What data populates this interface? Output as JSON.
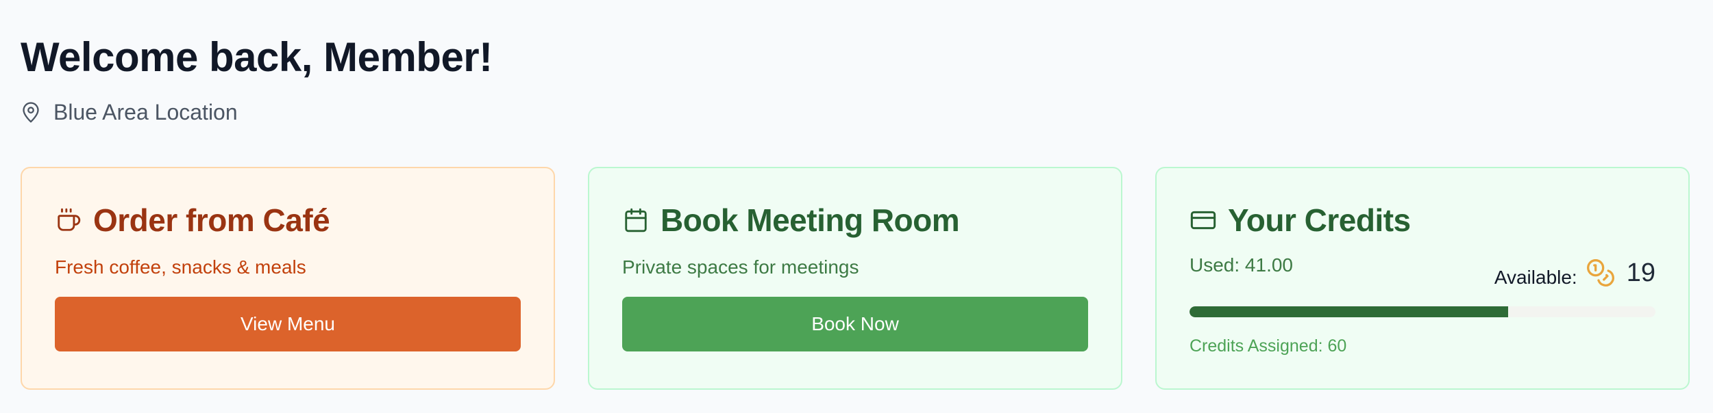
{
  "header": {
    "title": "Welcome back, Member!",
    "location": "Blue Area Location",
    "location_icon": "map-pin-icon"
  },
  "cards": {
    "cafe": {
      "icon": "coffee-cup-icon",
      "title": "Order from Café",
      "subtitle": "Fresh coffee, snacks & meals",
      "button_label": "View Menu"
    },
    "meeting": {
      "icon": "calendar-icon",
      "title": "Book Meeting Room",
      "subtitle": "Private spaces for meetings",
      "button_label": "Book Now"
    },
    "credits": {
      "icon": "credit-card-icon",
      "title": "Your Credits",
      "used_text": "Used: 41.00",
      "available_label": "Available:",
      "available_icon": "coins-icon",
      "available_value": "19",
      "assigned_text": "Credits Assigned: 60",
      "progress_used_fraction": 0.6833
    }
  },
  "colors": {
    "cafe_accent": "#dc632b",
    "meeting_accent": "#4da356",
    "credits_bar": "#2e6b36",
    "coin": "#e9a53c"
  }
}
